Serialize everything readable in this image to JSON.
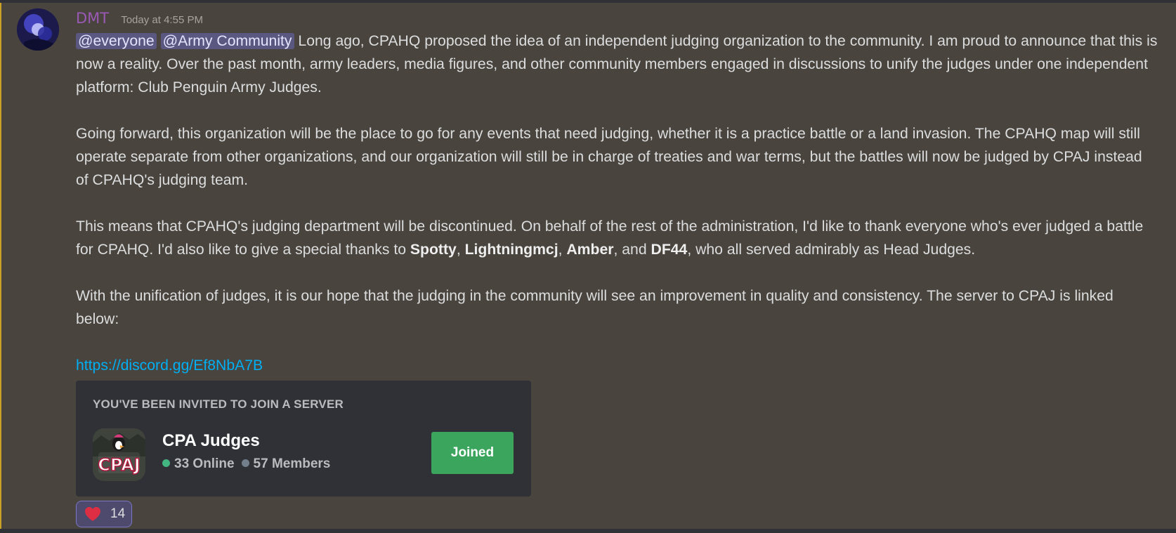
{
  "message": {
    "username": "DMT",
    "timestamp": "Today at 4:55 PM",
    "mention_everyone": "@everyone",
    "mention_role": "@Army Community",
    "p1_text": " Long ago, CPAHQ proposed the idea of an independent judging organization to the community.  I am proud to announce that this is now a reality.  Over the past month, army leaders, media figures, and other community members engaged in discussions to unify the judges under one independent platform: Club Penguin Army Judges.",
    "p2_text": "Going forward, this organization will be the place to go for any events that need judging, whether it is a practice battle or a land invasion.  The CPAHQ map will still operate separate from other organizations, and our organization will still be in charge of treaties and war terms, but the battles will now be judged by CPAJ instead of CPAHQ's judging team.",
    "p3_text_a": "This means that CPAHQ's judging department will be discontinued.  On behalf of the rest of the administration, I'd like to thank everyone who's ever judged a battle for CPAHQ.  I'd also like to give a special thanks to ",
    "p3_name1": "Spotty",
    "p3_sep1": ", ",
    "p3_name2": "Lightningmcj",
    "p3_sep2": ", ",
    "p3_name3": "Amber",
    "p3_sep3": ", and ",
    "p3_name4": "DF44",
    "p3_text_b": ", who all served admirably as Head Judges.",
    "p4_text": "With the unification of judges, it is our hope that the judging in the community will see an improvement in quality and consistency.  The server to CPAJ is linked below:",
    "link_text": "https://discord.gg/Ef8NbA7B"
  },
  "invite": {
    "title": "YOU'VE BEEN INVITED TO JOIN A SERVER",
    "server_name": "CPA Judges",
    "online_count": "33 Online",
    "member_count": "57 Members",
    "button_label": "Joined",
    "icon_text": "CPAJ"
  },
  "reaction": {
    "emoji": "heart-icon",
    "count": "14"
  },
  "colors": {
    "username": "#9b59b6",
    "link": "#00aff4",
    "joined_button": "#3ba55d",
    "online_dot": "#43b581",
    "members_dot": "#747f8d",
    "mention_bg": "#5a5781",
    "highlight_border": "#c9a227"
  }
}
